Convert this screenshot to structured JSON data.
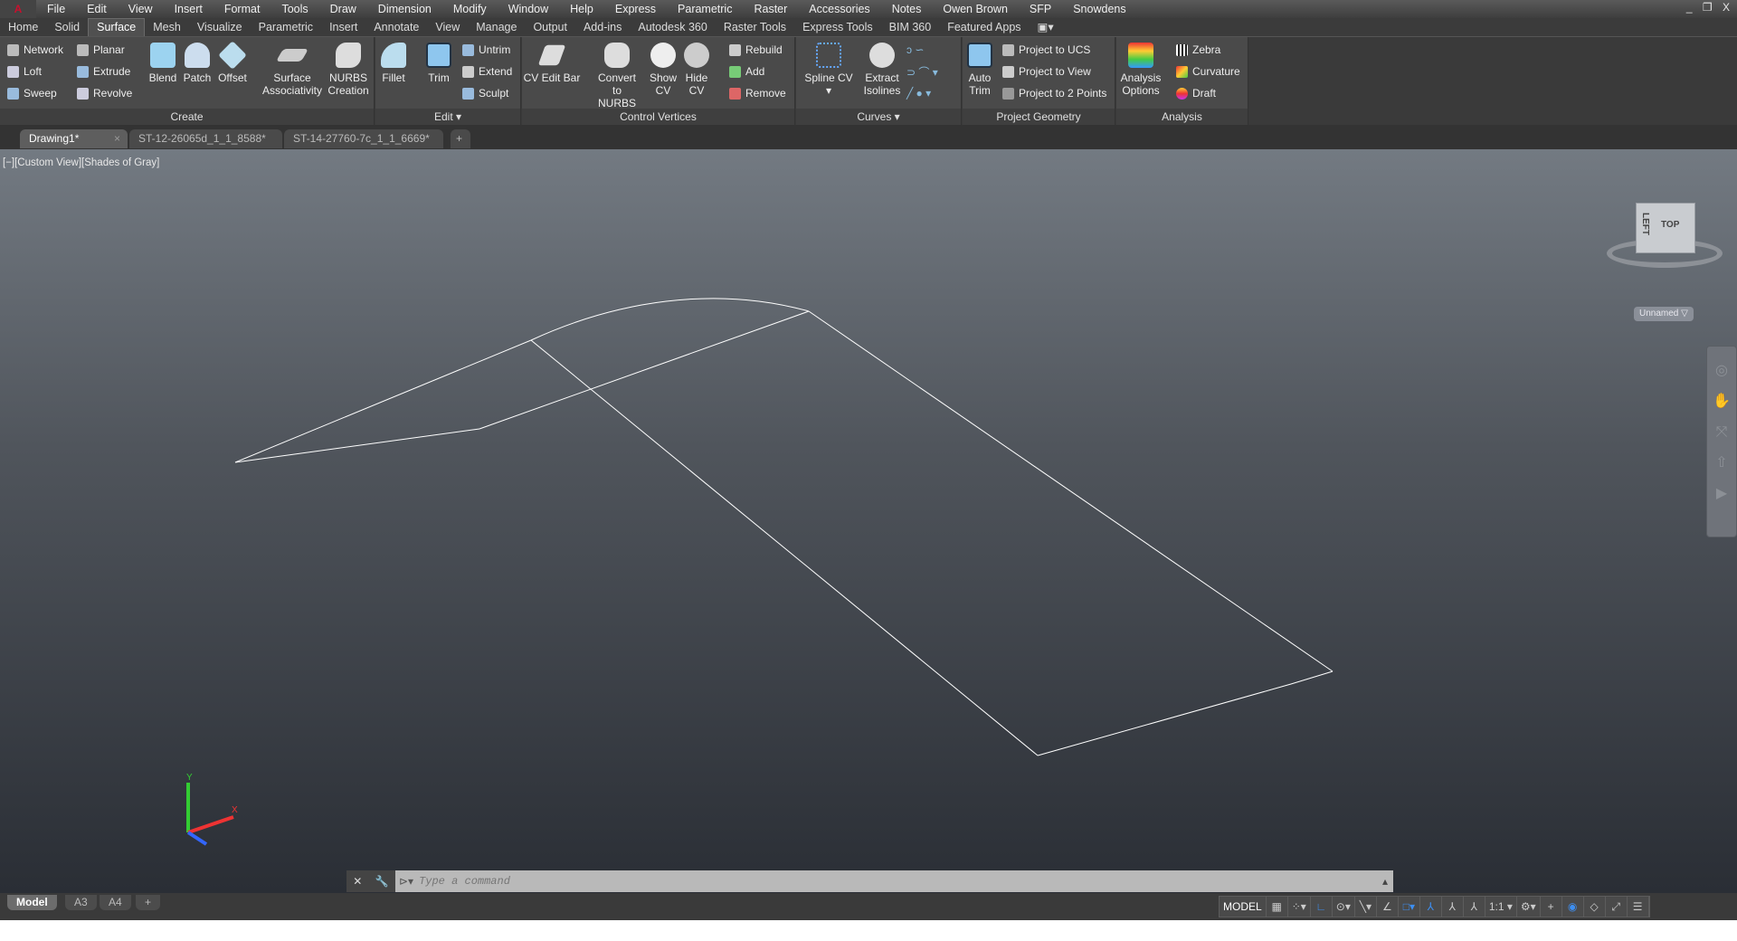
{
  "menubar": {
    "items": [
      "File",
      "Edit",
      "View",
      "Insert",
      "Format",
      "Tools",
      "Draw",
      "Dimension",
      "Modify",
      "Window",
      "Help",
      "Express",
      "Parametric",
      "Raster",
      "Accessories",
      "Notes",
      "Owen Brown",
      "SFP",
      "Snowdens"
    ]
  },
  "ribbon_tabs": [
    "Home",
    "Solid",
    "Surface",
    "Mesh",
    "Visualize",
    "Parametric",
    "Insert",
    "Annotate",
    "View",
    "Manage",
    "Output",
    "Add-ins",
    "Autodesk 360",
    "Raster Tools",
    "Express Tools",
    "BIM 360",
    "Featured Apps"
  ],
  "active_tab": "Surface",
  "panels": {
    "create": {
      "title": "Create",
      "small": [
        "Network",
        "Loft",
        "Sweep",
        "Planar",
        "Extrude",
        "Revolve"
      ],
      "big": [
        "Blend",
        "Patch",
        "Offset",
        "Surface Associativity",
        "NURBS Creation"
      ]
    },
    "edit": {
      "title": "Edit ▾",
      "big": [
        "Fillet",
        "Trim"
      ],
      "small": [
        "Untrim",
        "Extend",
        "Sculpt"
      ]
    },
    "cv": {
      "title": "Control Vertices",
      "big": [
        "CV Edit Bar",
        "Convert to NURBS",
        "Show CV",
        "Hide CV"
      ],
      "small": [
        "Rebuild",
        "Add",
        "Remove"
      ]
    },
    "curves": {
      "title": "Curves ▾",
      "big": [
        "Spline CV",
        "Extract Isolines"
      ]
    },
    "project": {
      "title": "Project Geometry",
      "big": [
        "Auto Trim"
      ],
      "small": [
        "Project to UCS",
        "Project to View",
        "Project to 2 Points"
      ]
    },
    "analysis": {
      "title": "Analysis",
      "big": [
        "Analysis Options"
      ],
      "small": [
        "Zebra",
        "Curvature",
        "Draft"
      ]
    }
  },
  "doc_tabs": [
    "Drawing1*",
    "ST-12-26065d_1_1_8588*",
    "ST-14-27760-7c_1_1_6669*"
  ],
  "viewport": {
    "label": "[−][Custom View][Shades of Gray]",
    "viewcube": {
      "left": "LEFT",
      "top": "TOP"
    },
    "view_menu": "Unnamed ▽"
  },
  "command": {
    "placeholder": "Type a command"
  },
  "layout_tabs": [
    "Model",
    "A3",
    "A4"
  ],
  "status": {
    "model": "MODEL",
    "scale": "1:1 ▾"
  },
  "colors": {
    "accent": "#3d8ef0",
    "wire": "#ffffff"
  }
}
